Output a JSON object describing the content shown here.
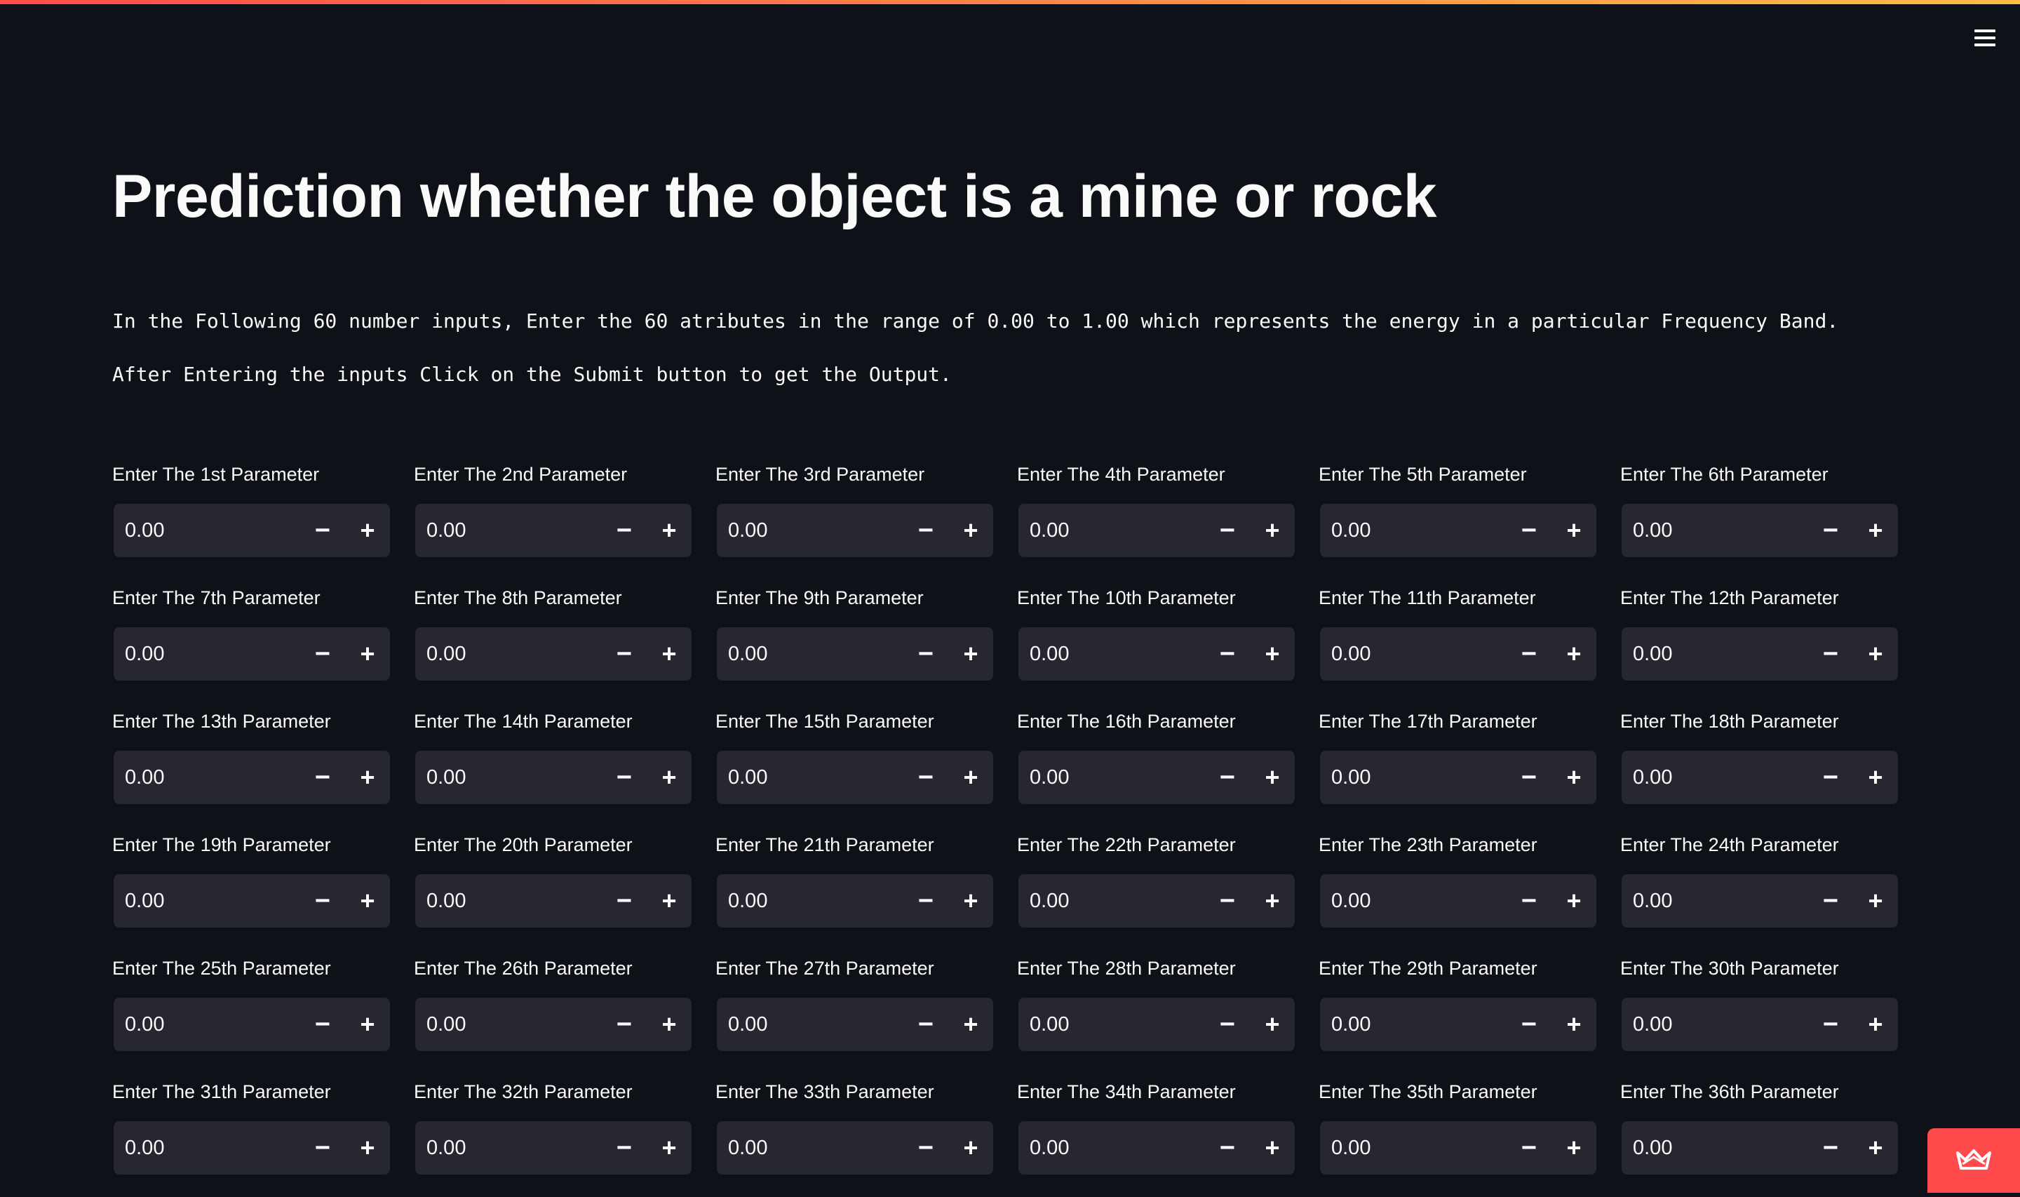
{
  "header": {
    "menu_icon": "hamburger-menu-icon"
  },
  "main": {
    "title": "Prediction whether the object is a mine or rock",
    "intro_line_1": "In the Following 60 number inputs, Enter the 60 atributes in the range of 0.00 to 1.00 which represents the energy in a particular Frequency Band.",
    "intro_line_2": "After Entering the inputs Click on the Submit button to get the Output."
  },
  "fields": [
    {
      "label": "Enter The 1st Parameter",
      "value": "0.00"
    },
    {
      "label": "Enter The 2nd Parameter",
      "value": "0.00"
    },
    {
      "label": "Enter The 3rd Parameter",
      "value": "0.00"
    },
    {
      "label": "Enter The 4th Parameter",
      "value": "0.00"
    },
    {
      "label": "Enter The 5th Parameter",
      "value": "0.00"
    },
    {
      "label": "Enter The 6th Parameter",
      "value": "0.00"
    },
    {
      "label": "Enter The 7th Parameter",
      "value": "0.00"
    },
    {
      "label": "Enter The 8th Parameter",
      "value": "0.00"
    },
    {
      "label": "Enter The 9th Parameter",
      "value": "0.00"
    },
    {
      "label": "Enter The 10th Parameter",
      "value": "0.00"
    },
    {
      "label": "Enter The 11th Parameter",
      "value": "0.00"
    },
    {
      "label": "Enter The 12th Parameter",
      "value": "0.00"
    },
    {
      "label": "Enter The 13th Parameter",
      "value": "0.00"
    },
    {
      "label": "Enter The 14th Parameter",
      "value": "0.00"
    },
    {
      "label": "Enter The 15th Parameter",
      "value": "0.00"
    },
    {
      "label": "Enter The 16th Parameter",
      "value": "0.00"
    },
    {
      "label": "Enter The 17th Parameter",
      "value": "0.00"
    },
    {
      "label": "Enter The 18th Parameter",
      "value": "0.00"
    },
    {
      "label": "Enter The 19th Parameter",
      "value": "0.00"
    },
    {
      "label": "Enter The 20th Parameter",
      "value": "0.00"
    },
    {
      "label": "Enter The 21th Parameter",
      "value": "0.00"
    },
    {
      "label": "Enter The 22th Parameter",
      "value": "0.00"
    },
    {
      "label": "Enter The 23th Parameter",
      "value": "0.00"
    },
    {
      "label": "Enter The 24th Parameter",
      "value": "0.00"
    },
    {
      "label": "Enter The 25th Parameter",
      "value": "0.00"
    },
    {
      "label": "Enter The 26th Parameter",
      "value": "0.00"
    },
    {
      "label": "Enter The 27th Parameter",
      "value": "0.00"
    },
    {
      "label": "Enter The 28th Parameter",
      "value": "0.00"
    },
    {
      "label": "Enter The 29th Parameter",
      "value": "0.00"
    },
    {
      "label": "Enter The 30th Parameter",
      "value": "0.00"
    },
    {
      "label": "Enter The 31th Parameter",
      "value": "0.00"
    },
    {
      "label": "Enter The 32th Parameter",
      "value": "0.00"
    },
    {
      "label": "Enter The 33th Parameter",
      "value": "0.00"
    },
    {
      "label": "Enter The 34th Parameter",
      "value": "0.00"
    },
    {
      "label": "Enter The 35th Parameter",
      "value": "0.00"
    },
    {
      "label": "Enter The 36th Parameter",
      "value": "0.00"
    }
  ],
  "stepper": {
    "minus_label": "−",
    "plus_label": "+"
  },
  "footer": {
    "badge_icon": "streamlit-crown-icon"
  },
  "colors": {
    "background": "#0e1117",
    "input_background": "#262730",
    "text": "#fafafa",
    "accent": "#ff4b4b"
  }
}
